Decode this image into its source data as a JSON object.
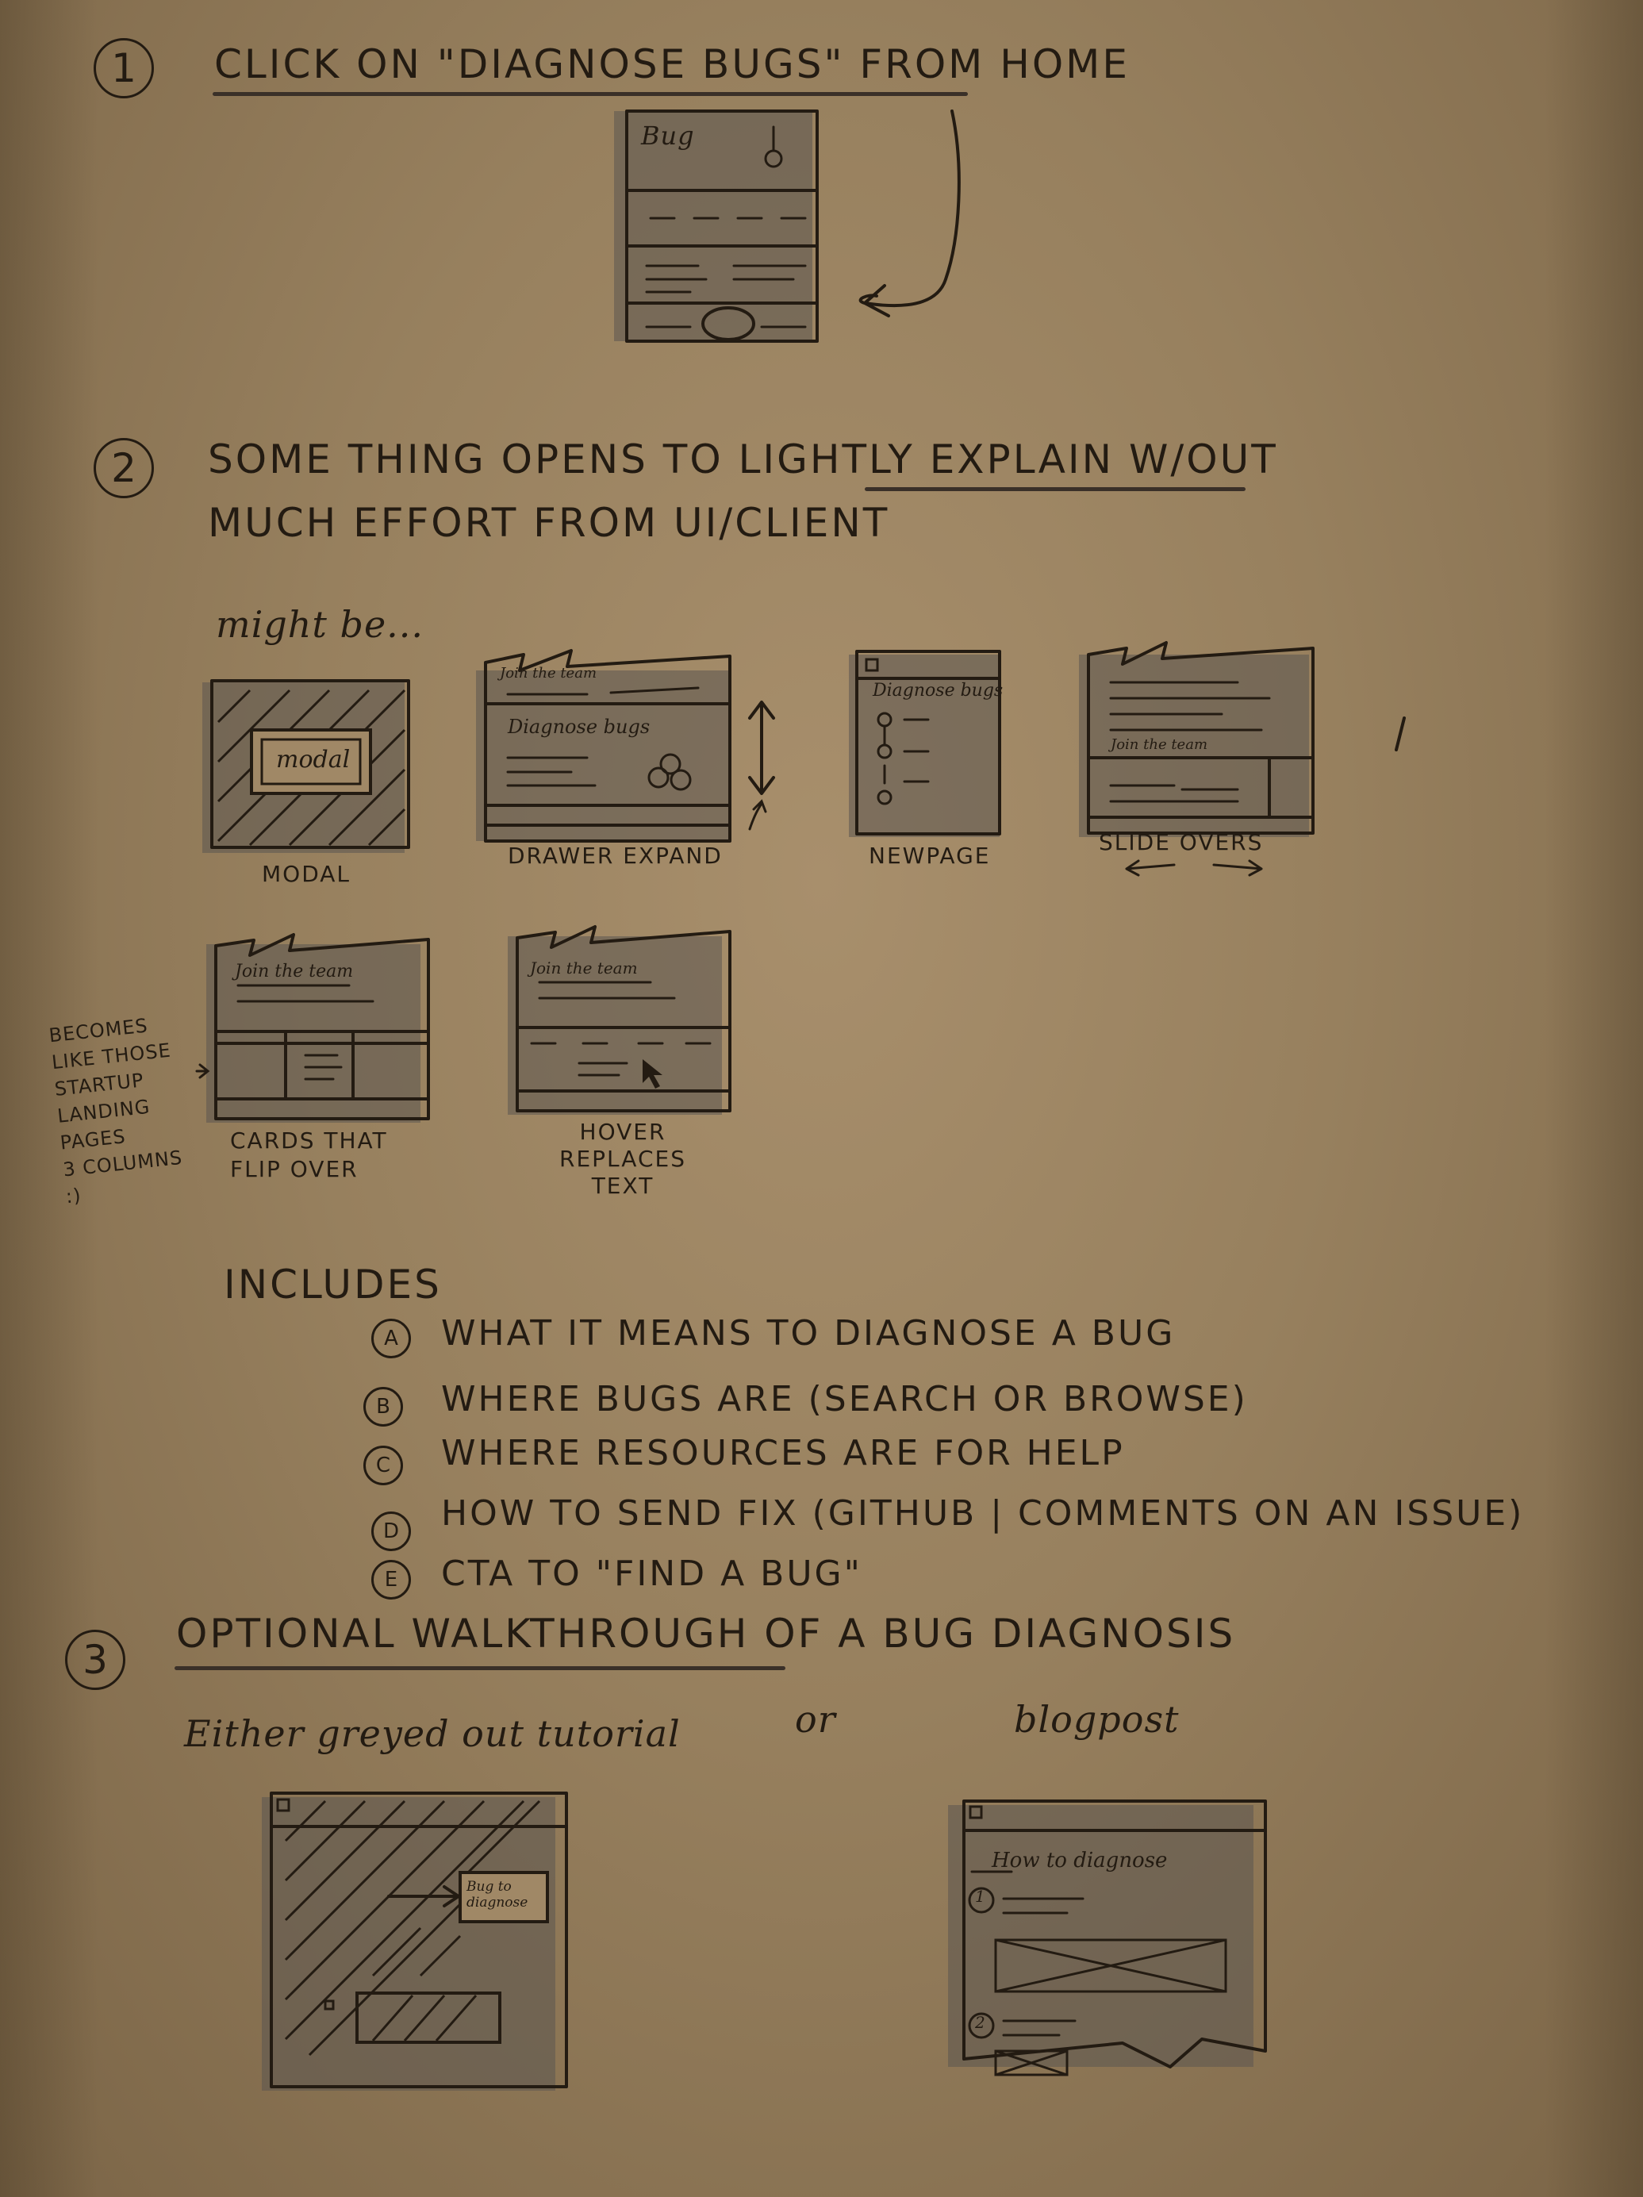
{
  "step1": {
    "number": "1",
    "text": "CLICK ON \"DIAGNOSE BUGS\" FROM HOME",
    "phone_label": "Bug"
  },
  "step2": {
    "number": "2",
    "line1": "SOME THING OPENS TO LIGHTLY EXPLAIN W/OUT",
    "line2": "MUCH EFFORT FROM UI/CLIENT",
    "might_be": "might be...",
    "options": [
      {
        "caption": "MODAL",
        "inner_label": "modal"
      },
      {
        "caption": "DRAWER EXPAND",
        "header": "Join the team",
        "inner_label": "Diagnose bugs"
      },
      {
        "caption": "NEWPAGE",
        "inner_label": "Diagnose bugs"
      },
      {
        "caption": "SLIDE OVERS",
        "inner_label": "Join the team"
      },
      {
        "caption": "CARDS THAT FLIP OVER",
        "inner_label": "Join the team"
      },
      {
        "caption": "HOVER REPLACES TEXT",
        "inner_label": "Join the team"
      }
    ],
    "side_note": "BECOMES\nLIKE THOSE\nSTARTUP\nLANDING\nPAGES\n3 COLUMNS\n:)"
  },
  "includes": {
    "title": "INCLUDES",
    "items": [
      {
        "marker": "A",
        "text": "WHAT IT MEANS TO DIAGNOSE A BUG"
      },
      {
        "marker": "B",
        "text": "WHERE BUGS ARE (SEARCH OR BROWSE)"
      },
      {
        "marker": "C",
        "text": "WHERE RESOURCES ARE FOR HELP"
      },
      {
        "marker": "D",
        "text": "HOW TO SEND FIX (GITHUB | COMMENTS ON AN ISSUE)"
      },
      {
        "marker": "E",
        "text": "CTA TO \"FIND A BUG\""
      }
    ]
  },
  "step3": {
    "number": "3",
    "text": "OPTIONAL WALKTHROUGH OF A BUG DIAGNOSIS",
    "either": "Either greyed out tutorial",
    "or": "or",
    "blogpost": "blogpost",
    "tutorial_callout": "Bug to diagnose",
    "blog_title": "How to diagnose",
    "blog_steps": [
      "1",
      "2"
    ]
  }
}
